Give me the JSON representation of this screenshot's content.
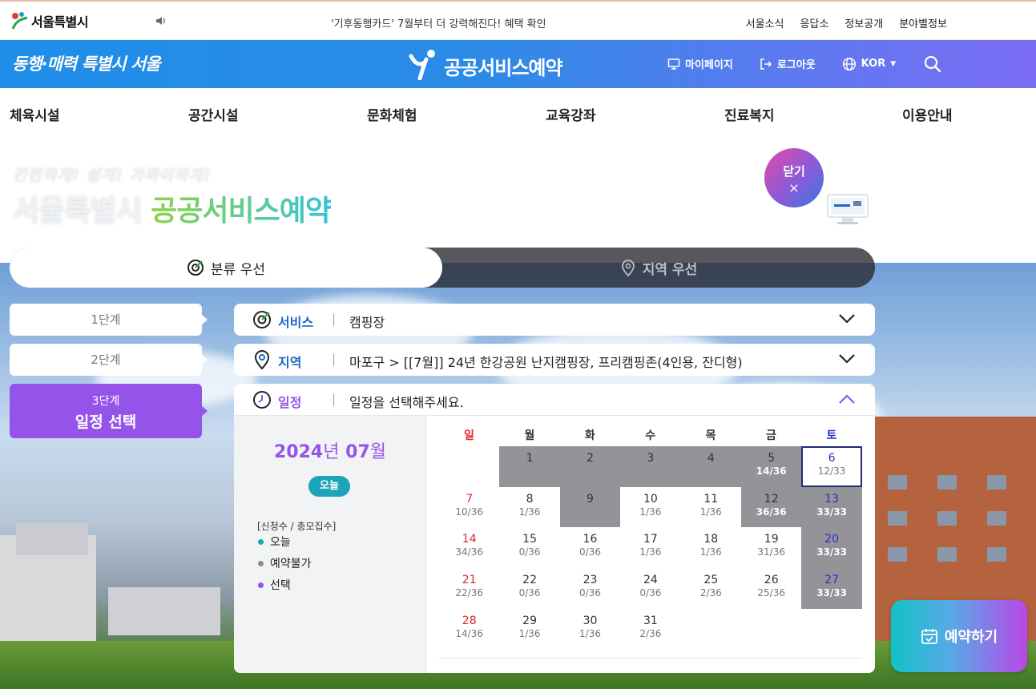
{
  "topbar": {
    "logo_text": "서울특별시",
    "notice": "'기후동행카드' 7월부터 더 강력해진다! 혜택 확인",
    "links": [
      "서울소식",
      "응답소",
      "정보공개",
      "분야별정보"
    ]
  },
  "brandbar": {
    "slogan": "동행·매력 특별시 서울",
    "service_title": "공공서비스예약",
    "mypage": "마이페이지",
    "logout": "로그아웃",
    "language": "KOR"
  },
  "nav": {
    "items": [
      "체육시설",
      "공간시설",
      "문화체험",
      "교육강좌",
      "진료복지",
      "이용안내"
    ]
  },
  "hero": {
    "tagline_small": "간편하게! 쉽게! 가까이하게!",
    "tagline_white": "서울특별시",
    "tagline_green": "공공서비스예약",
    "close_label": "닫기",
    "close_symbol": "×"
  },
  "tabs": {
    "category_first": "분류 우선",
    "region_first": "지역 우선"
  },
  "steps": {
    "step1": "1단계",
    "step2": "2단계",
    "step3_num": "3단계",
    "step3_title": "일정 선택"
  },
  "selection": {
    "service_label": "서비스",
    "service_value": "캠핑장",
    "region_label": "지역",
    "region_value": "마포구 > [[7월]] 24년 한강공원 난지캠핑장, 프리캠핑존(4인용, 잔디형)",
    "schedule_label": "일정",
    "schedule_value": "일정을 선택해주세요.",
    "separator": "|"
  },
  "calendar": {
    "year": "2024",
    "year_suffix": "년",
    "month": "07",
    "month_suffix": "월",
    "today_label": "오늘",
    "legend_title": "[신청수 / 총모집수]",
    "legend_today": "오늘",
    "legend_unavailable": "예약불가",
    "legend_selected": "선택",
    "weekdays": [
      "일",
      "월",
      "화",
      "수",
      "목",
      "금",
      "토"
    ],
    "days": [
      {
        "d": "1",
        "c": "",
        "col": 1,
        "row": 0,
        "state": "gray"
      },
      {
        "d": "2",
        "c": "",
        "col": 2,
        "row": 0,
        "state": "gray"
      },
      {
        "d": "3",
        "c": "",
        "col": 3,
        "row": 0,
        "state": "gray"
      },
      {
        "d": "4",
        "c": "",
        "col": 4,
        "row": 0,
        "state": "gray"
      },
      {
        "d": "5",
        "c": "14/36",
        "col": 5,
        "row": 0,
        "state": "gray"
      },
      {
        "d": "6",
        "c": "12/33",
        "col": 6,
        "row": 0,
        "state": "sel"
      },
      {
        "d": "7",
        "c": "10/36",
        "col": 0,
        "row": 1,
        "state": ""
      },
      {
        "d": "8",
        "c": "1/36",
        "col": 1,
        "row": 1,
        "state": ""
      },
      {
        "d": "9",
        "c": "",
        "col": 2,
        "row": 1,
        "state": "gray"
      },
      {
        "d": "10",
        "c": "1/36",
        "col": 3,
        "row": 1,
        "state": ""
      },
      {
        "d": "11",
        "c": "1/36",
        "col": 4,
        "row": 1,
        "state": ""
      },
      {
        "d": "12",
        "c": "36/36",
        "col": 5,
        "row": 1,
        "state": "gray"
      },
      {
        "d": "13",
        "c": "33/33",
        "col": 6,
        "row": 1,
        "state": "gray"
      },
      {
        "d": "14",
        "c": "34/36",
        "col": 0,
        "row": 2,
        "state": ""
      },
      {
        "d": "15",
        "c": "0/36",
        "col": 1,
        "row": 2,
        "state": ""
      },
      {
        "d": "16",
        "c": "0/36",
        "col": 2,
        "row": 2,
        "state": ""
      },
      {
        "d": "17",
        "c": "1/36",
        "col": 3,
        "row": 2,
        "state": ""
      },
      {
        "d": "18",
        "c": "1/36",
        "col": 4,
        "row": 2,
        "state": ""
      },
      {
        "d": "19",
        "c": "31/36",
        "col": 5,
        "row": 2,
        "state": ""
      },
      {
        "d": "20",
        "c": "33/33",
        "col": 6,
        "row": 2,
        "state": "gray"
      },
      {
        "d": "21",
        "c": "22/36",
        "col": 0,
        "row": 3,
        "state": ""
      },
      {
        "d": "22",
        "c": "0/36",
        "col": 1,
        "row": 3,
        "state": ""
      },
      {
        "d": "23",
        "c": "0/36",
        "col": 2,
        "row": 3,
        "state": ""
      },
      {
        "d": "24",
        "c": "0/36",
        "col": 3,
        "row": 3,
        "state": ""
      },
      {
        "d": "25",
        "c": "2/36",
        "col": 4,
        "row": 3,
        "state": ""
      },
      {
        "d": "26",
        "c": "25/36",
        "col": 5,
        "row": 3,
        "state": ""
      },
      {
        "d": "27",
        "c": "33/33",
        "col": 6,
        "row": 3,
        "state": "gray"
      },
      {
        "d": "28",
        "c": "14/36",
        "col": 0,
        "row": 4,
        "state": ""
      },
      {
        "d": "29",
        "c": "1/36",
        "col": 1,
        "row": 4,
        "state": ""
      },
      {
        "d": "30",
        "c": "1/36",
        "col": 2,
        "row": 4,
        "state": ""
      },
      {
        "d": "31",
        "c": "2/36",
        "col": 3,
        "row": 4,
        "state": ""
      }
    ]
  },
  "reserve": {
    "label": "예약하기"
  },
  "colors": {
    "accent_purple": "#9653ea",
    "accent_blue": "#1d67c7",
    "today_teal": "#1ea4b8",
    "unavailable_gray": "#939398"
  },
  "icons": [
    "seoul-logo-icon",
    "speaker-icon",
    "service-logo-icon",
    "monitor-icon",
    "logout-icon",
    "globe-icon",
    "search-icon",
    "target-icon",
    "location-pin-icon",
    "clock-icon",
    "chevron-down-icon",
    "chevron-up-icon",
    "calendar-check-icon"
  ]
}
